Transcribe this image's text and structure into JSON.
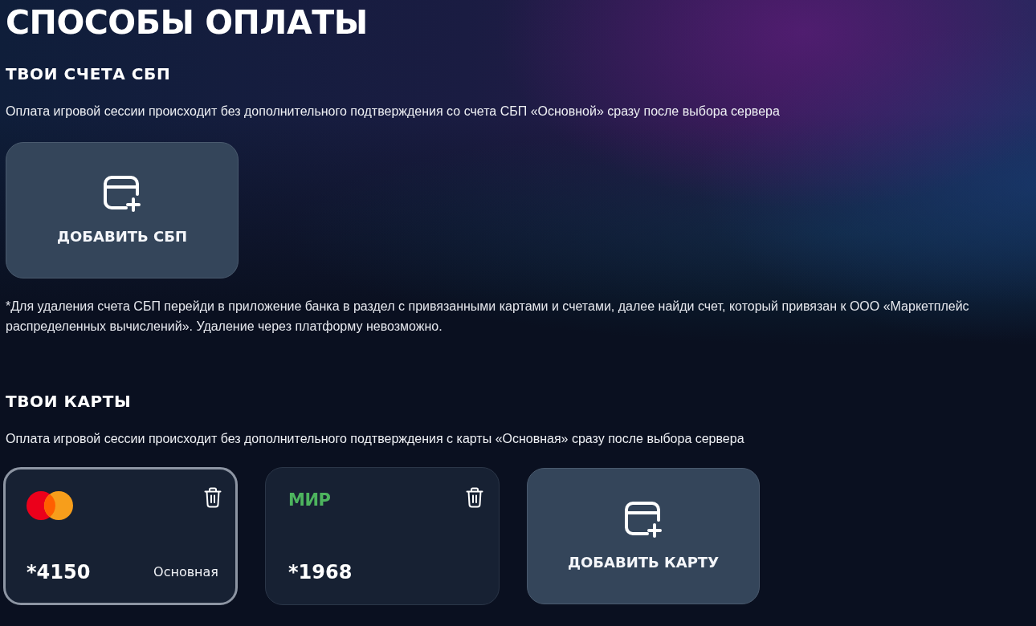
{
  "page": {
    "title": "СПОСОБЫ ОПЛАТЫ"
  },
  "sbp_section": {
    "heading": "ТВОИ СЧЕТА СБП",
    "description": "Оплата игровой сессии происходит без дополнительного подтверждения со счета СБП «Основной» сразу после выбора сервера",
    "add_button": {
      "label": "ДОБАВИТЬ СБП"
    },
    "note": "*Для удаления счета СБП перейди в приложение банка в раздел с привязанными картами и счетами, далее найди счет, который привязан к ООО «Маркетплейс распределенных вычислений». Удаление через платформу невозможно."
  },
  "cards_section": {
    "heading": "ТВОИ КАРТЫ",
    "description": "Оплата игровой сессии происходит без дополнительного подтверждения с карты «Основная» сразу после выбора сервера",
    "cards": [
      {
        "kind": "mastercard",
        "number": "*4150",
        "badge": "Основная",
        "selected": true
      },
      {
        "kind": "mir",
        "logo": "МИР",
        "number": "*1968",
        "selected": false
      }
    ],
    "add_button": {
      "label": "ДОБАВИТЬ КАРТУ"
    }
  }
}
